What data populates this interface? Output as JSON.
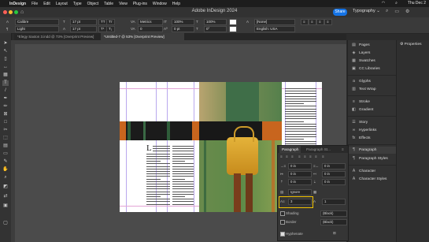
{
  "menubar": {
    "app": "InDesign",
    "items": [
      "File",
      "Edit",
      "Layout",
      "Type",
      "Object",
      "Table",
      "View",
      "Plug-ins",
      "Window",
      "Help"
    ],
    "clock": "Thu Dec 2"
  },
  "window": {
    "title": "Adobe InDesign 2024",
    "share_label": "Share",
    "workspace": "Typography"
  },
  "control": {
    "font_family": "Calibre",
    "font_style": "Light",
    "font_size": "17 pt",
    "leading": "17 pt",
    "kerning": "Metrics",
    "tracking": "0",
    "vscale": "100%",
    "hscale": "100%",
    "baseline": "0 pt",
    "skew": "0°",
    "char_style": "[None]",
    "language": "English: USA"
  },
  "tabs": [
    {
      "label": "*Elegy Saxton 3.indd @ 73% [Overprint Preview]",
      "active": false
    },
    {
      "label": "*Untitled-7 @ 53% [Overprint Preview]",
      "active": true
    }
  ],
  "dock": {
    "groups": [
      [
        "Pages",
        "Layers",
        "Swatches",
        "CC Libraries"
      ],
      [
        "Glyphs",
        "Text Wrap"
      ],
      [
        "Stroke",
        "Gradient"
      ],
      [
        "Story",
        "Hyperlinks",
        "Effects"
      ],
      [
        "Paragraph",
        "Paragraph Styles"
      ],
      [
        "Character",
        "Character Styles"
      ]
    ],
    "icons": [
      "pages-icon",
      "layers-icon",
      "swatches-icon",
      "cc-libraries-icon",
      "glyphs-icon",
      "text-wrap-icon",
      "stroke-icon",
      "gradient-icon",
      "story-icon",
      "hyperlinks-icon",
      "effects-icon",
      "paragraph-icon",
      "paragraph-styles-icon",
      "character-icon",
      "character-styles-icon"
    ],
    "properties_label": "Properties"
  },
  "paragraph_panel": {
    "tabs": [
      "Paragraph",
      "Paragraph St..."
    ],
    "left_indent": "0 in",
    "right_indent": "0 in",
    "first_line_indent": "0 in",
    "last_line_indent": "0 in",
    "space_before": "0 in",
    "space_after": "0 in",
    "align_mode": "Ignore",
    "drop_cap_lines": "3",
    "drop_cap_chars": "1",
    "shading_label": "Shading",
    "border_label": "Border",
    "shading_color": "(Black)",
    "border_color": "(Black)",
    "hyphenate_label": "Hyphenate",
    "hyphenate_checked": true
  },
  "colors": {
    "accent": "#1473e6",
    "highlight": "#f2c200",
    "bag": "#d6a02a"
  }
}
